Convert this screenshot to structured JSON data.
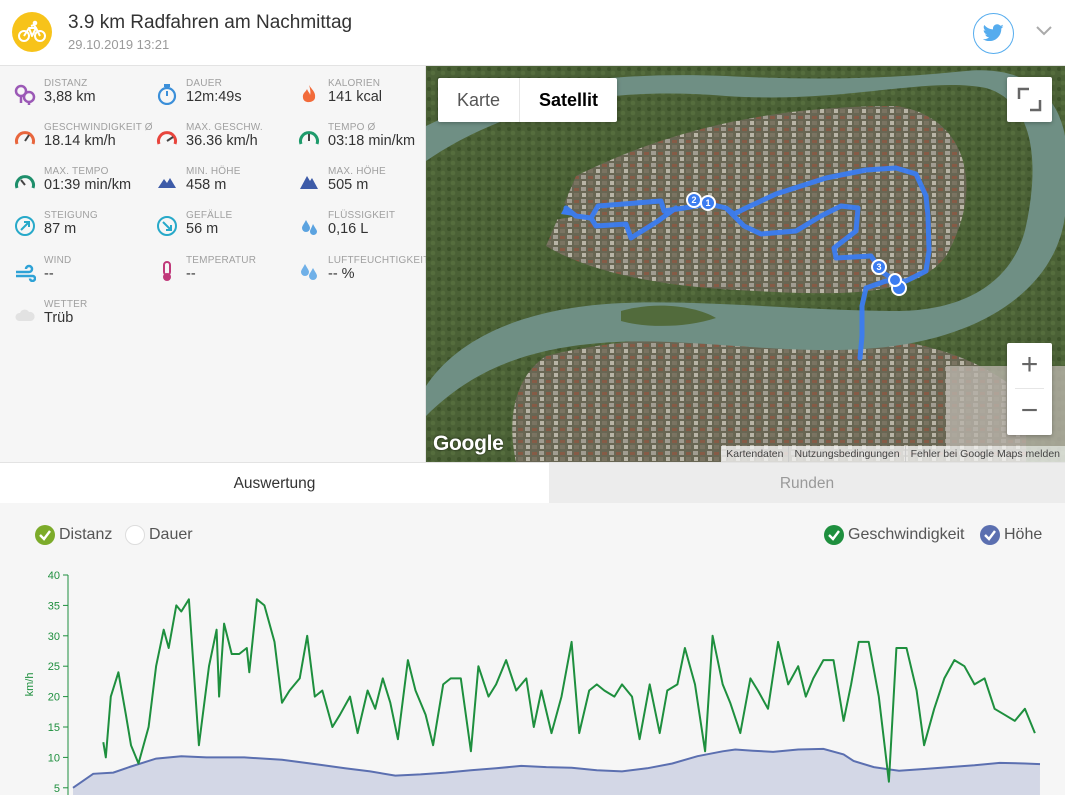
{
  "header": {
    "title": "3.9 km Radfahren am Nachmittag",
    "date": "29.10.2019 13:21",
    "sport_icon": "bicycle-icon",
    "share_icon": "twitter-icon"
  },
  "stats": [
    {
      "label": "DISTANZ",
      "value": "3,88 km",
      "icon": "distance-icon",
      "color": "#9b59b6"
    },
    {
      "label": "DAUER",
      "value": "12m:49s",
      "icon": "stopwatch-icon",
      "color": "#3b8fd9"
    },
    {
      "label": "KALORIEN",
      "value": "141 kcal",
      "icon": "flame-icon",
      "color": "#f26b3a"
    },
    {
      "label": "GESCHWINDIGKEIT Ø",
      "value": "18.14 km/h",
      "icon": "speedometer-icon",
      "color": "#e8663d"
    },
    {
      "label": "MAX. GESCHW.",
      "value": "36.36 km/h",
      "icon": "speedometer-max-icon",
      "color": "#e8453d"
    },
    {
      "label": "TEMPO Ø",
      "value": "03:18 min/km",
      "icon": "pace-icon",
      "color": "#1e9b6b"
    },
    {
      "label": "MAX. TEMPO",
      "value": "01:39 min/km",
      "icon": "pace-max-icon",
      "color": "#1e8f6b"
    },
    {
      "label": "MIN. HÖHE",
      "value": "458 m",
      "icon": "mountain-min-icon",
      "color": "#3d5ba8"
    },
    {
      "label": "MAX. HÖHE",
      "value": "505 m",
      "icon": "mountain-max-icon",
      "color": "#3d5ba8"
    },
    {
      "label": "STEIGUNG",
      "value": "87 m",
      "icon": "ascent-icon",
      "color": "#27a9c9"
    },
    {
      "label": "GEFÄLLE",
      "value": "56 m",
      "icon": "descent-icon",
      "color": "#27a9c9"
    },
    {
      "label": "FLÜSSIGKEIT",
      "value": "0,16 L",
      "icon": "water-drops-icon",
      "color": "#5ba3e0"
    },
    {
      "label": "WIND",
      "value": "--",
      "icon": "wind-icon",
      "color": "#2ea2d6"
    },
    {
      "label": "TEMPERATUR",
      "value": "--",
      "icon": "thermometer-icon",
      "color": "#c0397a"
    },
    {
      "label": "LUFTFEUCHTIGKEIT",
      "value": "-- %",
      "icon": "humidity-icon",
      "color": "#6fb0e8"
    },
    {
      "label": "WETTER",
      "value": "Trüb",
      "icon": "cloud-icon",
      "color": "#e2e2e2"
    }
  ],
  "map": {
    "type_options": [
      "Karte",
      "Satellit"
    ],
    "selected_type": "Satellit",
    "zoom_in": "+",
    "zoom_out": "−",
    "logo": "Google",
    "attribution": [
      "Kartendaten",
      "Nutzungsbedingungen",
      "Fehler bei Google Maps melden"
    ],
    "markers": [
      "1",
      "2",
      "3"
    ]
  },
  "tabs": [
    {
      "label": "Auswertung",
      "active": true
    },
    {
      "label": "Runden",
      "active": false
    }
  ],
  "chart_toggles": {
    "distance": "Distanz",
    "duration": "Dauer",
    "speed": "Geschwindigkeit",
    "altitude": "Höhe"
  },
  "colors": {
    "speed": "#1e8f3e",
    "altitude_line": "#5b6fb0",
    "altitude_fill": "#d3d7e6",
    "toggle_green": "#7cab2a",
    "toggle_blue": "#5b6fb0",
    "route": "#3b7cf0"
  },
  "chart_data": {
    "type": "line",
    "ylabel": "km/h",
    "ylim": [
      5,
      40
    ],
    "yticks": [
      5,
      10,
      15,
      20,
      25,
      30,
      35,
      40
    ],
    "xlim": [
      0,
      3.88
    ],
    "grid": false,
    "legend": "top-right",
    "series": [
      {
        "name": "Geschwindigkeit",
        "x": [
          0.14,
          0.15,
          0.17,
          0.2,
          0.23,
          0.25,
          0.28,
          0.32,
          0.35,
          0.38,
          0.4,
          0.43,
          0.45,
          0.48,
          0.52,
          0.56,
          0.59,
          0.6,
          0.62,
          0.65,
          0.68,
          0.71,
          0.72,
          0.75,
          0.78,
          0.82,
          0.85,
          0.88,
          0.92,
          0.95,
          0.98,
          1.01,
          1.05,
          1.08,
          1.12,
          1.15,
          1.19,
          1.22,
          1.25,
          1.28,
          1.31,
          1.35,
          1.38,
          1.42,
          1.45,
          1.49,
          1.52,
          1.56,
          1.6,
          1.63,
          1.67,
          1.7,
          1.74,
          1.78,
          1.82,
          1.85,
          1.88,
          1.92,
          1.96,
          2.0,
          2.03,
          2.07,
          2.1,
          2.13,
          2.17,
          2.2,
          2.24,
          2.27,
          2.31,
          2.35,
          2.38,
          2.42,
          2.45,
          2.49,
          2.53,
          2.56,
          2.6,
          2.63,
          2.67,
          2.71,
          2.74,
          2.78,
          2.82,
          2.86,
          2.9,
          2.93,
          2.96,
          3.0,
          3.04,
          3.08,
          3.11,
          3.14,
          3.18,
          3.22,
          3.26,
          3.29,
          3.33,
          3.37,
          3.4,
          3.44,
          3.48,
          3.52,
          3.56,
          3.6,
          3.64,
          3.68,
          3.72,
          3.76,
          3.8,
          3.84
        ],
        "values": [
          12.5,
          10,
          20,
          24,
          17,
          12,
          9,
          15,
          25,
          31,
          28,
          35,
          34,
          36,
          12,
          25,
          31,
          20,
          32,
          27,
          27,
          28,
          24,
          36,
          35,
          29,
          19,
          21,
          23,
          30,
          20,
          21,
          15,
          17,
          20,
          14,
          21,
          18,
          23,
          19,
          13,
          26,
          21,
          17,
          12,
          22,
          23,
          23,
          11,
          25,
          20,
          22,
          26,
          21,
          23,
          15,
          21,
          14,
          20,
          29,
          14,
          21,
          22,
          21,
          20,
          22,
          20,
          13,
          22,
          14,
          21,
          22,
          28,
          22,
          11,
          30,
          22,
          19,
          14,
          23,
          21,
          18,
          29,
          22,
          25,
          20,
          23,
          26,
          26,
          16,
          22,
          29,
          29,
          20,
          6,
          28,
          28,
          21,
          12,
          18,
          23,
          26,
          25,
          22,
          23,
          18,
          17,
          16,
          18,
          14
        ]
      },
      {
        "name": "Höhe",
        "x": [
          0.02,
          0.1,
          0.18,
          0.25,
          0.35,
          0.45,
          0.55,
          0.7,
          0.85,
          1.0,
          1.1,
          1.2,
          1.3,
          1.4,
          1.5,
          1.6,
          1.7,
          1.8,
          1.9,
          2.0,
          2.1,
          2.2,
          2.3,
          2.4,
          2.5,
          2.6,
          2.65,
          2.72,
          2.8,
          2.9,
          3.0,
          3.08,
          3.12,
          3.2,
          3.3,
          3.4,
          3.5,
          3.6,
          3.7,
          3.8,
          3.86
        ],
        "values": [
          5,
          7.3,
          7.5,
          8.5,
          9.8,
          10.2,
          10,
          10,
          9.6,
          8.8,
          8.2,
          7.7,
          7,
          7.2,
          7.5,
          7.9,
          8.2,
          8.6,
          8.4,
          8.3,
          7.9,
          7.7,
          8.2,
          9,
          10.2,
          11,
          11.3,
          11.1,
          10.9,
          11.3,
          11.4,
          10.5,
          9.4,
          8.4,
          7.8,
          8.1,
          8.4,
          8.7,
          9.1,
          9,
          8.9
        ]
      }
    ]
  }
}
